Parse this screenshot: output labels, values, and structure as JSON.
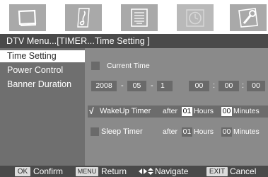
{
  "tabs": [
    {
      "icon": "picture-icon"
    },
    {
      "icon": "music-note-icon"
    },
    {
      "icon": "channel-list-icon"
    },
    {
      "icon": "clock-icon",
      "selected": true
    },
    {
      "icon": "wrench-icon"
    }
  ],
  "breadcrumb": "DTV Menu...[TIMER...Time Setting ]",
  "sidebar": {
    "items": [
      {
        "label": "Time Setting",
        "active": true
      },
      {
        "label": "Power Control"
      },
      {
        "label": "Banner Duration"
      }
    ]
  },
  "time_setting": {
    "current_time_label": "Current Time",
    "date": {
      "year": "2008",
      "month": "05",
      "day": "1"
    },
    "date_sep": "-",
    "time": {
      "hour": "00",
      "minute": "00",
      "second": "00"
    },
    "time_sep": ":"
  },
  "wakeup": {
    "check_mark": "√",
    "label": "WakeUp Timer",
    "after": "after",
    "hours_value": "01",
    "hours_label": "Hours",
    "minutes_value": "00",
    "minutes_label": "Minutes"
  },
  "sleep": {
    "label": "Sleep Timer",
    "after": "after",
    "hours_value": "01",
    "hours_label": "Hours",
    "minutes_value": "00",
    "minutes_label": "Minutes"
  },
  "hints": {
    "ok_key": "OK",
    "ok_label": "Confirm",
    "menu_key": "MENU",
    "menu_label": "Return",
    "nav_label": "Navigate",
    "exit_key": "EXIT",
    "exit_label": "Cancel"
  },
  "colors": {
    "panel": "#8a8a8a",
    "sidebar": "#6f6f6f",
    "bar": "#4a4a4a",
    "field": "#6a6a6a"
  }
}
